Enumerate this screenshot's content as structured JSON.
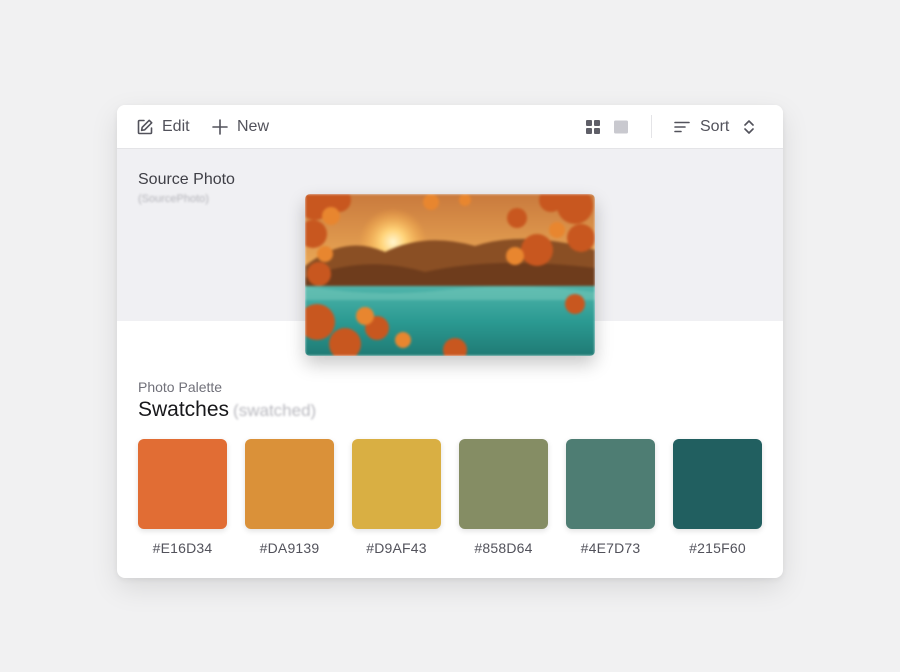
{
  "toolbar": {
    "edit_label": "Edit",
    "new_label": "New",
    "sort_label": "Sort"
  },
  "source": {
    "title": "Source Photo",
    "tag": "(SourcePhoto)",
    "photo_description": "Autumn lake at sunset framed by orange maple leaves"
  },
  "palette": {
    "label": "Photo Palette",
    "title": "Swatches",
    "tag": "(swatched)",
    "swatches": [
      {
        "hex": "#E16D34"
      },
      {
        "hex": "#DA9139"
      },
      {
        "hex": "#D9AF43"
      },
      {
        "hex": "#858D64"
      },
      {
        "hex": "#4E7D73"
      },
      {
        "hex": "#215F60"
      }
    ]
  }
}
